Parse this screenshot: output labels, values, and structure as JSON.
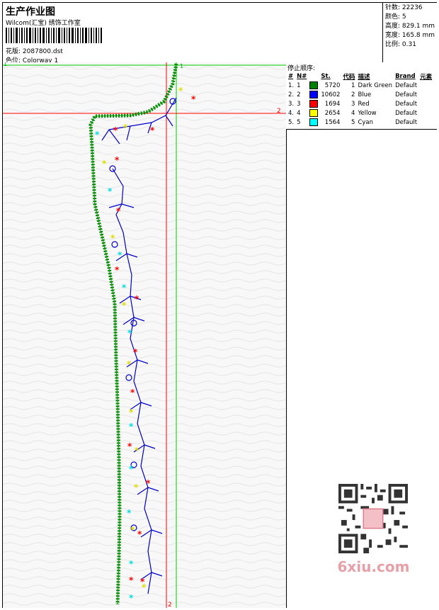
{
  "header": {
    "title": "生产作业图",
    "company": "Wilcom(汇宝) 绣饰工作室",
    "design_label": "花版:",
    "design_value": "2087800.dst",
    "colorway_label": "色位:",
    "colorway_value": "Colorway 1"
  },
  "stats": {
    "stitches": "针数: 22236",
    "colors": "颜色: 5",
    "height": "高度: 829.1 mm",
    "width": "宽度: 165.8 mm",
    "scale": "比例: 0.31"
  },
  "stop_sequence": {
    "title": "停止顺序:",
    "headers": [
      "#",
      "N#",
      "St.",
      "代码",
      "描述",
      "Brand",
      "元素"
    ],
    "rows": [
      {
        "idx": "1.",
        "n": "1",
        "st": "5720",
        "code": "1",
        "desc": "Dark Green",
        "brand": "Default",
        "color": "#008000"
      },
      {
        "idx": "2.",
        "n": "2",
        "st": "10602",
        "code": "2",
        "desc": "Blue",
        "brand": "Default",
        "color": "#0000ff"
      },
      {
        "idx": "3.",
        "n": "3",
        "st": "1694",
        "code": "3",
        "desc": "Red",
        "brand": "Default",
        "color": "#ff0000"
      },
      {
        "idx": "4.",
        "n": "4",
        "st": "2654",
        "code": "4",
        "desc": "Yellow",
        "brand": "Default",
        "color": "#ffff00"
      },
      {
        "idx": "5.",
        "n": "5",
        "st": "1564",
        "code": "5",
        "desc": "Cyan",
        "brand": "Default",
        "color": "#00ffff"
      }
    ]
  },
  "canvas": {
    "guide_label_1": "1",
    "guide_label_2": "2"
  },
  "watermark": {
    "site": "6xiu.com"
  },
  "colors": {
    "green": "#008000",
    "blue": "#0000ff",
    "red": "#ff0000",
    "yellow": "#ffff00",
    "cyan": "#00ffff",
    "guide_green": "#00cc00",
    "guide_red": "#ff0000"
  }
}
